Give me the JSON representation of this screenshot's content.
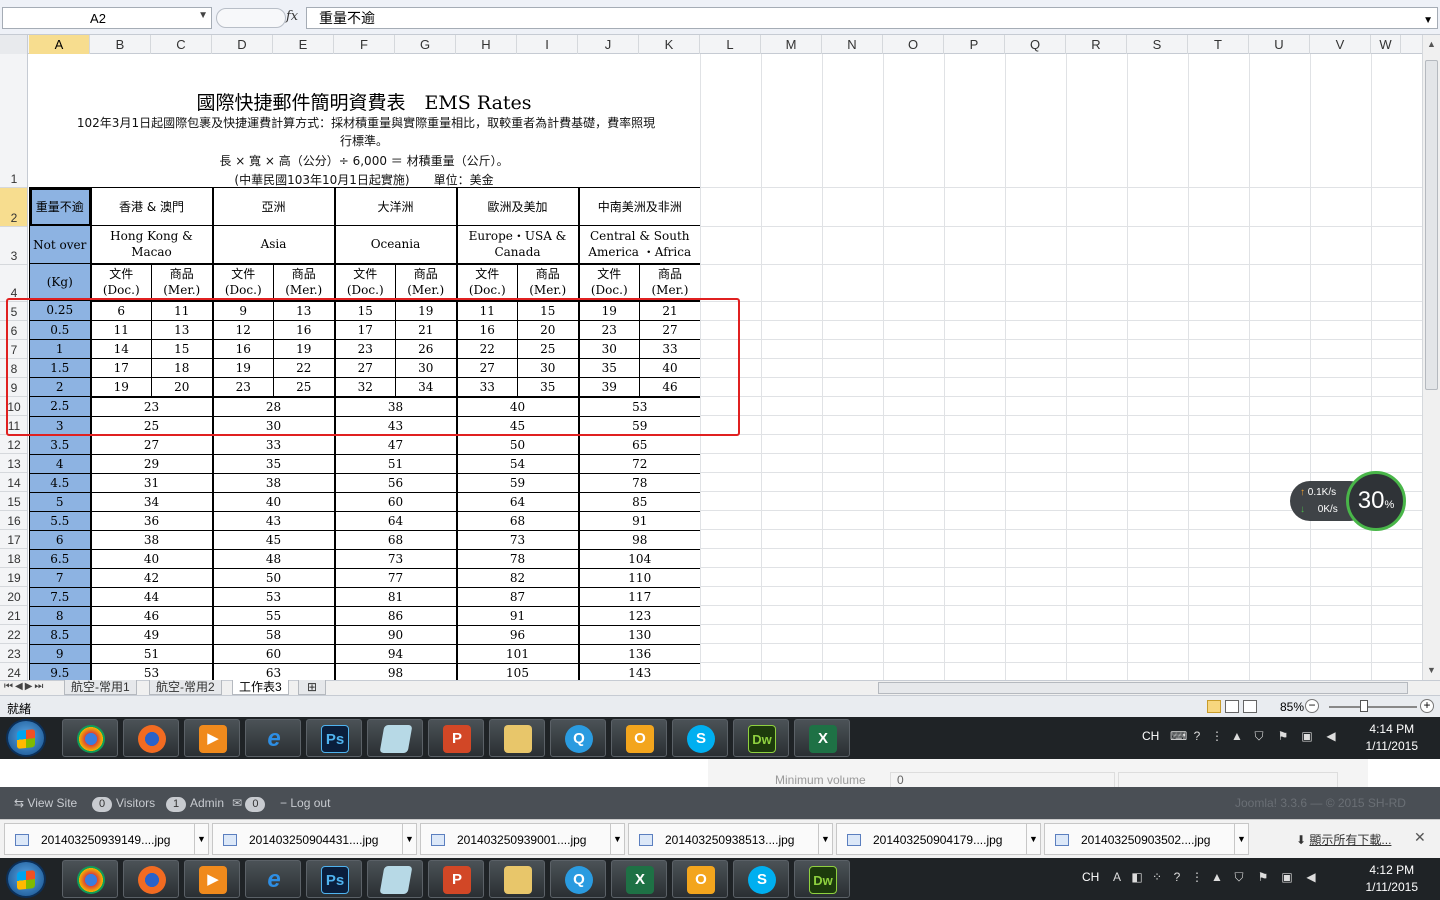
{
  "formula_bar": {
    "cell_ref": "A2",
    "fx": "fx",
    "content": "重量不逾"
  },
  "columns": [
    "A",
    "B",
    "C",
    "D",
    "E",
    "F",
    "G",
    "H",
    "I",
    "J",
    "K",
    "L",
    "M",
    "N",
    "O",
    "P",
    "Q",
    "R",
    "S",
    "T",
    "U",
    "V",
    "W"
  ],
  "rows": [
    "1",
    "2",
    "3",
    "4",
    "5",
    "6",
    "7",
    "8",
    "9",
    "10",
    "11",
    "12",
    "13",
    "14",
    "15",
    "16",
    "17",
    "18",
    "19",
    "20",
    "21",
    "22",
    "23",
    "24"
  ],
  "sheet": {
    "title": "國際快捷郵件簡明資費表　EMS Rates",
    "subtitle_line1": "102年3月1日起國際包裹及快捷運費計算方式：採材積重量與實際重量相比，取較重者為計費基礎，費率照現",
    "subtitle_line2": "行標準。",
    "subtitle_line3": "長 × 寬 × 高（公分）÷ 6,000 ＝ 材積重量（公斤）。",
    "subtitle_line4": "(中華民國103年10月1日起實施)　　單位：美金",
    "header_weight_zh": "重量不逾",
    "header_weight_en": "Not over",
    "header_weight_unit": "(Kg)",
    "regions": [
      {
        "zh": "香港 & 澳門",
        "en": "Hong Kong & Macao"
      },
      {
        "zh": "亞洲",
        "en": "Asia"
      },
      {
        "zh": "大洋洲",
        "en": "Oceania"
      },
      {
        "zh": "歐洲及美加",
        "en": "Europe・USA & Canada"
      },
      {
        "zh": "中南美洲及非洲",
        "en": "Central & South America ・Africa"
      }
    ],
    "doc_label_zh": "文件",
    "doc_label_en": "(Doc.)",
    "mer_label_zh": "商品",
    "mer_label_en": "(Mer.)",
    "split_rows": [
      {
        "kg": "0.25",
        "v": [
          "6",
          "11",
          "9",
          "13",
          "15",
          "19",
          "11",
          "15",
          "19",
          "21"
        ]
      },
      {
        "kg": "0.5",
        "v": [
          "11",
          "13",
          "12",
          "16",
          "17",
          "21",
          "16",
          "20",
          "23",
          "27"
        ]
      },
      {
        "kg": "1",
        "v": [
          "14",
          "15",
          "16",
          "19",
          "23",
          "26",
          "22",
          "25",
          "30",
          "33"
        ]
      },
      {
        "kg": "1.5",
        "v": [
          "17",
          "18",
          "19",
          "22",
          "27",
          "30",
          "27",
          "30",
          "35",
          "40"
        ]
      },
      {
        "kg": "2",
        "v": [
          "19",
          "20",
          "23",
          "25",
          "32",
          "34",
          "33",
          "35",
          "39",
          "46"
        ]
      }
    ],
    "merged_rows": [
      {
        "kg": "2.5",
        "v": [
          "23",
          "28",
          "38",
          "40",
          "53"
        ]
      },
      {
        "kg": "3",
        "v": [
          "25",
          "30",
          "43",
          "45",
          "59"
        ]
      },
      {
        "kg": "3.5",
        "v": [
          "27",
          "33",
          "47",
          "50",
          "65"
        ]
      },
      {
        "kg": "4",
        "v": [
          "29",
          "35",
          "51",
          "54",
          "72"
        ]
      },
      {
        "kg": "4.5",
        "v": [
          "31",
          "38",
          "56",
          "59",
          "78"
        ]
      },
      {
        "kg": "5",
        "v": [
          "34",
          "40",
          "60",
          "64",
          "85"
        ]
      },
      {
        "kg": "5.5",
        "v": [
          "36",
          "43",
          "64",
          "68",
          "91"
        ]
      },
      {
        "kg": "6",
        "v": [
          "38",
          "45",
          "68",
          "73",
          "98"
        ]
      },
      {
        "kg": "6.5",
        "v": [
          "40",
          "48",
          "73",
          "78",
          "104"
        ]
      },
      {
        "kg": "7",
        "v": [
          "42",
          "50",
          "77",
          "82",
          "110"
        ]
      },
      {
        "kg": "7.5",
        "v": [
          "44",
          "53",
          "81",
          "87",
          "117"
        ]
      },
      {
        "kg": "8",
        "v": [
          "46",
          "55",
          "86",
          "91",
          "123"
        ]
      },
      {
        "kg": "8.5",
        "v": [
          "49",
          "58",
          "90",
          "96",
          "130"
        ]
      },
      {
        "kg": "9",
        "v": [
          "51",
          "60",
          "94",
          "101",
          "136"
        ]
      },
      {
        "kg": "9.5",
        "v": [
          "53",
          "63",
          "98",
          "105",
          "143"
        ]
      }
    ]
  },
  "tabs": [
    "航空-常用1",
    "航空-常用2",
    "工作表3"
  ],
  "status": {
    "ready": "就緒",
    "zoom": "85%"
  },
  "net_widget": {
    "up": "0.1K/s",
    "down": "0K/s",
    "percent": "30",
    "percent_unit": "%"
  },
  "taskbar_top": {
    "lang": "CH",
    "time": "4:14 PM",
    "date": "1/11/2015"
  },
  "taskbar_bottom": {
    "lang": "CH",
    "time": "4:12 PM",
    "date": "1/11/2015"
  },
  "joomla": {
    "min_volume_label": "Minimum volume",
    "min_volume_value": "0",
    "view_site": "View Site",
    "visitors_count": "0",
    "visitors_label": "Visitors",
    "admin_count": "1",
    "admin_label": "Admin",
    "mail_count": "0",
    "logout": "Log out",
    "version": "Joomla! 3.3.6 — © 2015 SH-RD"
  },
  "downloads": [
    "201403250939149....jpg",
    "201403250904431....jpg",
    "201403250939001....jpg",
    "201403250938513....jpg",
    "201403250904179....jpg",
    "201403250903502....jpg"
  ],
  "show_all_downloads": "顯示所有下載...",
  "colors": {
    "kg_fill": "#8db3e2",
    "highlight_box": "#e02020",
    "active_header": "#f7dd8f"
  }
}
